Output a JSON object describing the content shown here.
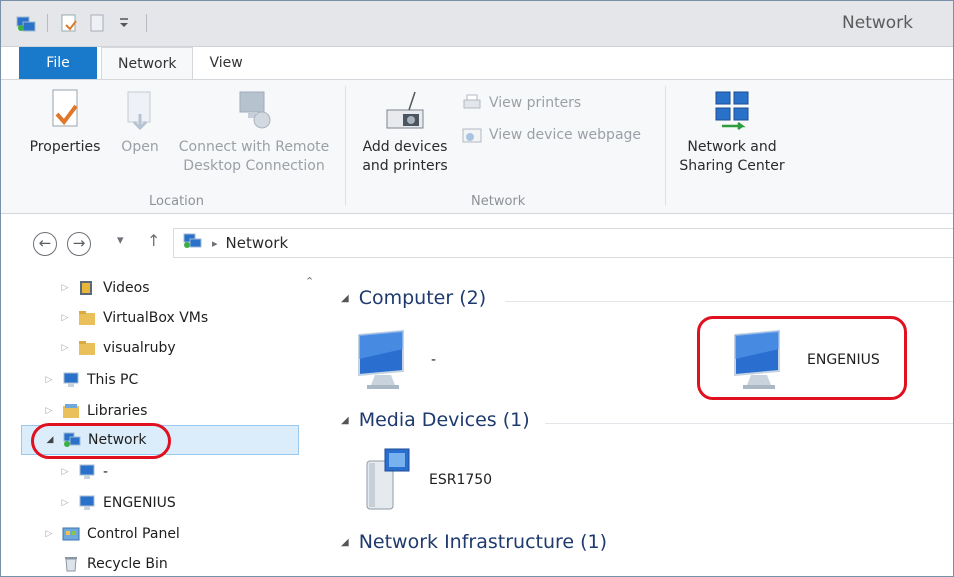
{
  "window": {
    "title": "Network"
  },
  "tabs": [
    {
      "label": "File"
    },
    {
      "label": "Network"
    },
    {
      "label": "View"
    }
  ],
  "ribbon": {
    "location": {
      "properties": "Properties",
      "open": "Open",
      "connect_line1": "Connect with Remote",
      "connect_line2": "Desktop Connection",
      "label": "Location"
    },
    "network": {
      "add_devices_line1": "Add devices",
      "add_devices_line2": "and printers",
      "view_printers": "View printers",
      "view_device_webpage": "View device webpage",
      "label": "Network"
    },
    "sharing": {
      "line1": "Network and",
      "line2": "Sharing Center"
    }
  },
  "address": {
    "crumb_sep": "▸",
    "crumb": "Network"
  },
  "nav": {
    "items": [
      {
        "label": "Videos"
      },
      {
        "label": "VirtualBox VMs"
      },
      {
        "label": "visualruby"
      },
      {
        "label": "This PC"
      },
      {
        "label": "Libraries"
      },
      {
        "label": "Network"
      },
      {
        "label": "-"
      },
      {
        "label": "ENGENIUS"
      },
      {
        "label": "Control Panel"
      },
      {
        "label": "Recycle Bin"
      }
    ]
  },
  "content": {
    "groups": [
      {
        "title": "Computer (2)"
      },
      {
        "title": "Media Devices (1)"
      },
      {
        "title": "Network Infrastructure (1)"
      }
    ],
    "computers": [
      {
        "name": "-"
      },
      {
        "name": "ENGENIUS"
      }
    ],
    "media": [
      {
        "name": "ESR1750"
      }
    ]
  },
  "colors": {
    "file_tab": "#1979ca",
    "highlight": "#e01020",
    "selection": "#dbecfa"
  }
}
